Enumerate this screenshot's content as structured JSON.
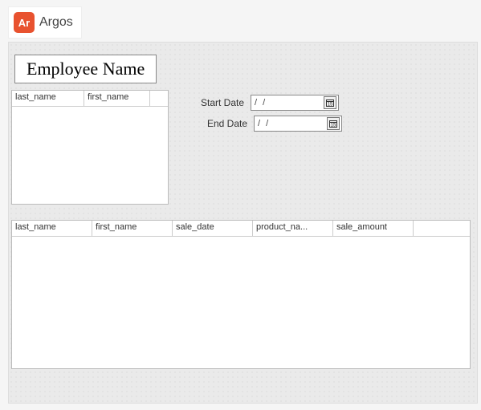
{
  "brand": {
    "badge": "Ar",
    "name": "Argos"
  },
  "title": "Employee Name",
  "employee_table": {
    "columns": [
      "last_name",
      "first_name"
    ],
    "rows": []
  },
  "dates": {
    "start_label": "Start Date",
    "start_value": "  /  /",
    "end_label": "End Date",
    "end_value": "  /  /"
  },
  "results_table": {
    "columns": [
      "last_name",
      "first_name",
      "sale_date",
      "product_na...",
      "sale_amount"
    ],
    "rows": []
  }
}
